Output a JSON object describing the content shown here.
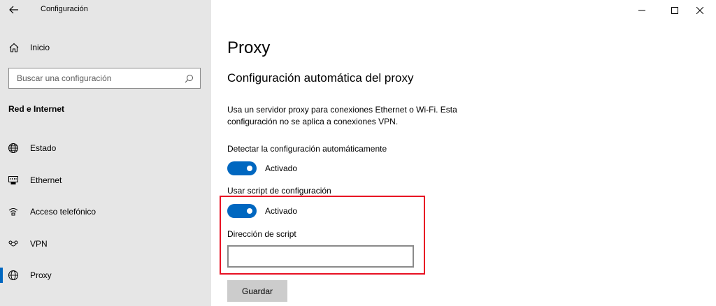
{
  "window": {
    "title": "Configuración"
  },
  "sidebar": {
    "home_label": "Inicio",
    "search_placeholder": "Buscar una configuración",
    "section_heading": "Red e Internet",
    "items": [
      {
        "label": "Estado",
        "icon": "globe-icon"
      },
      {
        "label": "Ethernet",
        "icon": "ethernet-icon"
      },
      {
        "label": "Acceso telefónico",
        "icon": "dialup-icon"
      },
      {
        "label": "VPN",
        "icon": "vpn-icon"
      },
      {
        "label": "Proxy",
        "icon": "globe-icon",
        "selected": true
      }
    ]
  },
  "main": {
    "title": "Proxy",
    "subtitle": "Configuración automática del proxy",
    "description_line1": "Usa un servidor proxy para conexiones Ethernet o Wi-Fi. Esta",
    "description_line2": "configuración no se aplica a conexiones VPN.",
    "auto_detect": {
      "label": "Detectar la configuración automáticamente",
      "state": "Activado"
    },
    "use_script": {
      "label": "Usar script de configuración",
      "state": "Activado"
    },
    "script_address": {
      "label": "Dirección de script",
      "value": ""
    },
    "save_label": "Guardar"
  },
  "colors": {
    "accent": "#0067c0",
    "sidebar_bg": "#e6e6e6",
    "highlight": "#e81123"
  }
}
